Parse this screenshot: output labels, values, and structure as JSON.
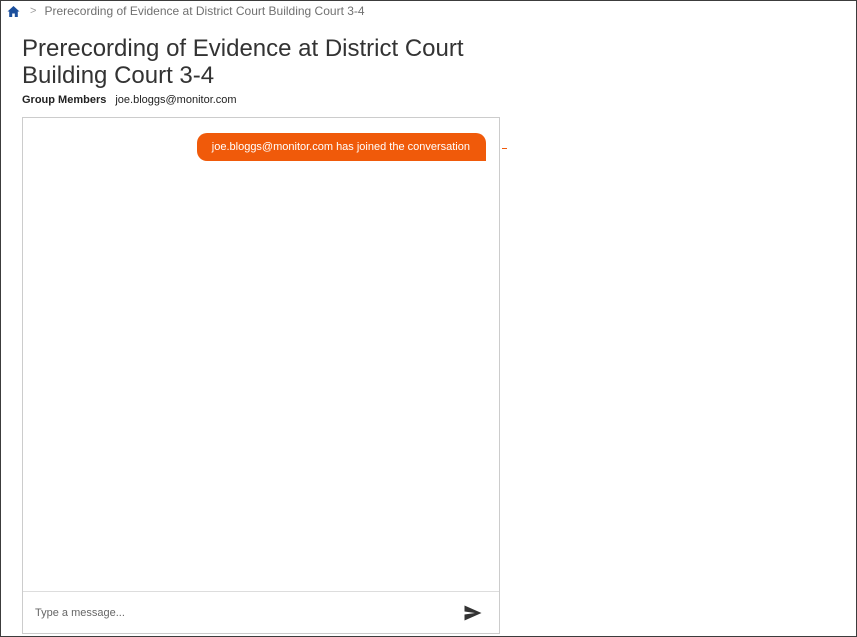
{
  "breadcrumb": {
    "separator": ">",
    "current": "Prerecording of Evidence at District Court Building Court 3-4"
  },
  "page": {
    "title": "Prerecording of Evidence at District Court Building Court 3-4"
  },
  "members": {
    "label": "Group Members",
    "value": "joe.bloggs@monitor.com"
  },
  "chat": {
    "messages": [
      {
        "text": "joe.bloggs@monitor.com has joined the conversation"
      }
    ],
    "input": {
      "placeholder": "Type a message...",
      "value": ""
    }
  },
  "colors": {
    "accent": "#f05a0a",
    "home_icon": "#1b4f9c",
    "text": "#333333",
    "border": "#cccccc"
  },
  "icons": {
    "home": "home-icon",
    "send": "send-icon"
  }
}
